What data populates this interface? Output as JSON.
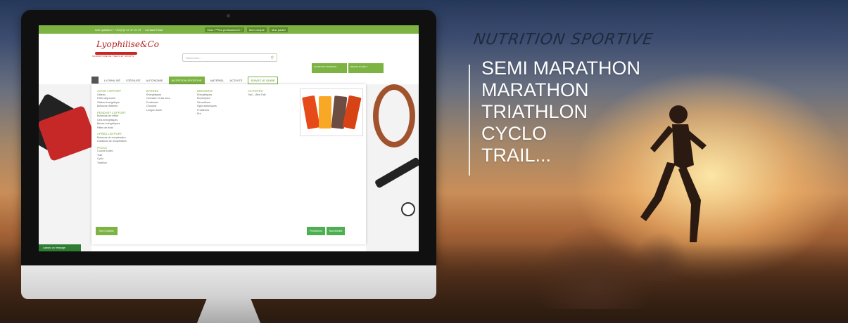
{
  "headline": "NUTRITION SPORTIVE",
  "events": [
    "SEMI MARATHON",
    "MARATHON",
    "TRIATHLON",
    "CYCLO",
    "TRAIL..."
  ],
  "colors": {
    "accent_green": "#7cb342",
    "headline_color": "#1f2a3d"
  },
  "site": {
    "topbar": {
      "phone_question": "Une question ? +33 (0)2 47 47 20 79",
      "contact": "Contact Email",
      "pro": "Vous √™tes professionnel ?",
      "account": "Mon compte",
      "cart": "Mon panier"
    },
    "logo": "Lyophilise&Co",
    "logo_tagline": "NOURRITURE DE TREKS ET SPORTS",
    "search_placeholder": "Recherche...",
    "badges": [
      "NUTRITION SPORTIVE",
      "BESOIN D'AIDE ?"
    ],
    "nav": [
      "LYOPHILISÉ",
      "STÉRILISÉ",
      "AUTONOMIE",
      "NUTRITION SPORTIVE",
      "MATÉRIEL",
      "ACTIVITÉ",
      "SUIVEZ LE GUIDE"
    ],
    "mega_columns": [
      {
        "heading": "AVANT L'EFFORT",
        "items": [
          "Gâteau",
          "Petits déjeuners",
          "Gâteau énergétique",
          "Boissons d'attente"
        ]
      },
      {
        "heading": "BARRES",
        "items": [
          "Énergétiques",
          "Céréales / fruits secs",
          "Protéinées",
          "Chocolat",
          "Longue durée"
        ]
      },
      {
        "heading": "BOISSONS",
        "items": [
          "Énergétiques",
          "Électrolytes",
          "Sérovélines",
          "Hypo-isotoniques",
          "Protéinées",
          "Pré"
        ]
      },
      {
        "heading": "ACTIVITÉS",
        "items": [
          "Trail - Ultra Trail"
        ]
      }
    ],
    "mega_column_sections": [
      {
        "heading": "PENDANT L'EFFORT",
        "items": [
          "Boissons de l'effort",
          "Gels énergétiques",
          "Barres énergétiques",
          "Pâtes de fruits"
        ]
      },
      {
        "heading": "APRÈS L'EFFORT",
        "items": [
          "Boissons de récupération",
          "Collations de récupération"
        ]
      },
      {
        "heading": "PACKS",
        "items": [
          "Course à pied",
          "Trail",
          "Cyclo",
          "Triathlon"
        ]
      }
    ],
    "mega_footer": "Nos Conseils",
    "mega_buttons": [
      "Promotions",
      "Nouveautés"
    ],
    "chat": "Laissez un message"
  }
}
